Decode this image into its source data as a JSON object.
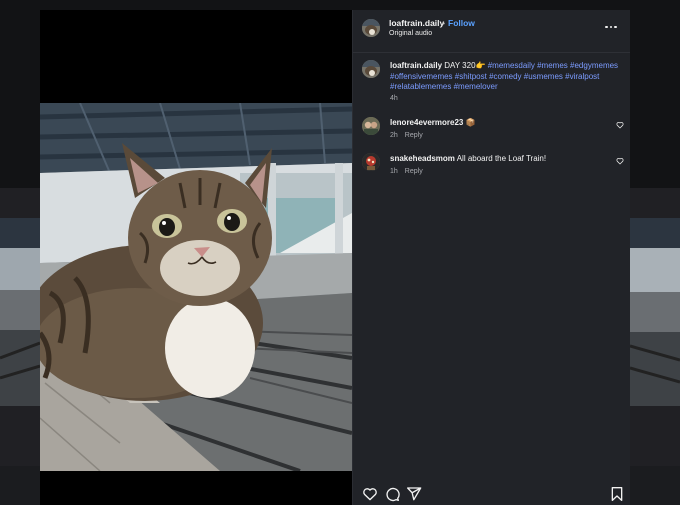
{
  "post": {
    "username": "loaftrain.daily",
    "separator": "•",
    "follow_label": "Follow",
    "audio": "Original audio",
    "more_label": "More options",
    "caption": {
      "username": "loaftrain.daily",
      "text": "DAY 320👉",
      "hashtags": [
        "#memesdaily",
        "#memes",
        "#edgymemes",
        "#offensivememes",
        "#shitpost",
        "#comedy",
        "#usmemes",
        "#viralpost",
        "#relatablememes",
        "#memelover"
      ],
      "time": "4h"
    },
    "comments": [
      {
        "username": "lenore4evermore23",
        "text": "📦",
        "time": "2h",
        "reply_label": "Reply"
      },
      {
        "username": "snakeheadsmom",
        "text": "All aboard the Loaf Train!",
        "time": "1h",
        "reply_label": "Reply"
      }
    ]
  },
  "actions": {
    "like": "heart-icon",
    "comment": "comment-icon",
    "share": "share-icon",
    "save": "bookmark-icon"
  },
  "colors": {
    "panel_bg": "#212328",
    "link": "#5aa1ff",
    "hashtag": "#7c9cff",
    "muted": "#a9abb0"
  }
}
